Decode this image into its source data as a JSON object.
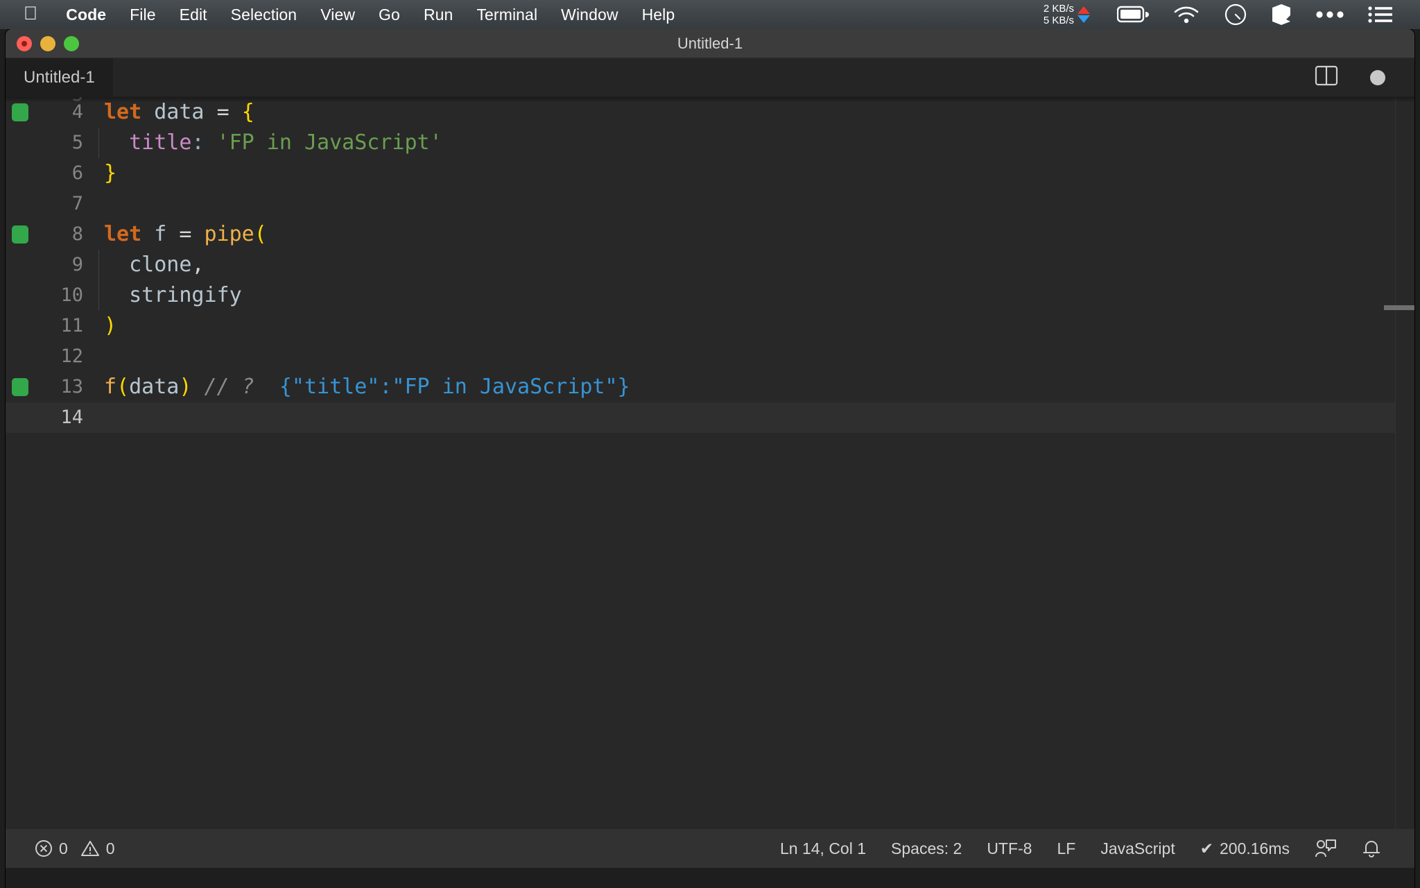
{
  "menubar": {
    "apple_glyph": "",
    "items": [
      {
        "label": "Code",
        "bold": true
      },
      {
        "label": "File",
        "bold": false
      },
      {
        "label": "Edit",
        "bold": false
      },
      {
        "label": "Selection",
        "bold": false
      },
      {
        "label": "View",
        "bold": false
      },
      {
        "label": "Go",
        "bold": false
      },
      {
        "label": "Run",
        "bold": false
      },
      {
        "label": "Terminal",
        "bold": false
      },
      {
        "label": "Window",
        "bold": false
      },
      {
        "label": "Help",
        "bold": false
      }
    ],
    "network": {
      "up": "2 KB/s",
      "down": "5 KB/s"
    },
    "icons": [
      "battery-icon",
      "wifi-icon",
      "control-center-icon",
      "app-icon",
      "more-icon",
      "list-icon"
    ]
  },
  "window": {
    "title": "Untitled-1",
    "traffic_lights": [
      "close-button",
      "minimize-button",
      "maximize-button"
    ]
  },
  "tabbar": {
    "tab_label": "Untitled-1",
    "split_editor_icon": "split-editor-icon",
    "unsaved_indicator": "unsaved-dot-icon"
  },
  "editor": {
    "lines": [
      {
        "number": "4",
        "gutter": true,
        "indent": false,
        "active": false,
        "tokens": [
          {
            "t": "let",
            "c": "kw"
          },
          {
            "t": " ",
            "c": "op"
          },
          {
            "t": "data",
            "c": "var"
          },
          {
            "t": " ",
            "c": "op"
          },
          {
            "t": "=",
            "c": "op"
          },
          {
            "t": " ",
            "c": "op"
          },
          {
            "t": "{",
            "c": "brc"
          }
        ]
      },
      {
        "number": "5",
        "gutter": false,
        "indent": true,
        "active": false,
        "tokens": [
          {
            "t": "  ",
            "c": "op"
          },
          {
            "t": "title",
            "c": "prop"
          },
          {
            "t": ":",
            "c": "colon"
          },
          {
            "t": " ",
            "c": "op"
          },
          {
            "t": "'FP in JavaScript'",
            "c": "str"
          }
        ]
      },
      {
        "number": "6",
        "gutter": false,
        "indent": false,
        "active": false,
        "tokens": [
          {
            "t": "}",
            "c": "brc"
          }
        ]
      },
      {
        "number": "7",
        "gutter": false,
        "indent": false,
        "active": false,
        "tokens": []
      },
      {
        "number": "8",
        "gutter": true,
        "indent": false,
        "active": false,
        "tokens": [
          {
            "t": "let",
            "c": "kw"
          },
          {
            "t": " ",
            "c": "op"
          },
          {
            "t": "f",
            "c": "var"
          },
          {
            "t": " ",
            "c": "op"
          },
          {
            "t": "=",
            "c": "op"
          },
          {
            "t": " ",
            "c": "op"
          },
          {
            "t": "pipe",
            "c": "fn"
          },
          {
            "t": "(",
            "c": "brc"
          }
        ]
      },
      {
        "number": "9",
        "gutter": false,
        "indent": true,
        "active": false,
        "tokens": [
          {
            "t": "  ",
            "c": "op"
          },
          {
            "t": "clone",
            "c": "var"
          },
          {
            "t": ",",
            "c": "op"
          }
        ]
      },
      {
        "number": "10",
        "gutter": false,
        "indent": true,
        "active": false,
        "tokens": [
          {
            "t": "  ",
            "c": "op"
          },
          {
            "t": "stringify",
            "c": "var"
          }
        ]
      },
      {
        "number": "11",
        "gutter": false,
        "indent": false,
        "active": false,
        "tokens": [
          {
            "t": ")",
            "c": "brc"
          }
        ]
      },
      {
        "number": "12",
        "gutter": false,
        "indent": false,
        "active": false,
        "tokens": []
      },
      {
        "number": "13",
        "gutter": true,
        "indent": false,
        "active": false,
        "tokens": [
          {
            "t": "f",
            "c": "fn"
          },
          {
            "t": "(",
            "c": "brc"
          },
          {
            "t": "data",
            "c": "var"
          },
          {
            "t": ")",
            "c": "brc"
          },
          {
            "t": " ",
            "c": "op"
          },
          {
            "t": "// ?",
            "c": "cmt"
          },
          {
            "t": "  ",
            "c": "op"
          },
          {
            "t": "{\"title\":\"FP in JavaScript\"}",
            "c": "res"
          }
        ]
      },
      {
        "number": "14",
        "gutter": false,
        "indent": false,
        "active": true,
        "tokens": []
      }
    ],
    "overview_marker": "overview-ruler-marker"
  },
  "statusbar": {
    "errors": "0",
    "warnings": "0",
    "cursor": "Ln 14, Col 1",
    "indentation": "Spaces: 2",
    "encoding": "UTF-8",
    "eol": "LF",
    "language": "JavaScript",
    "runtime": "200.16ms",
    "runtime_check": "✔",
    "feedback_icon": "feedback-icon",
    "bell_icon": "bell-icon"
  },
  "colors": {
    "editor_bg": "#282828",
    "gutter_marker_green": "#32a84a",
    "keyword_orange": "#d2691e",
    "brace_yellow": "#ffd700",
    "string_green": "#6a9e52",
    "property_purple": "#c98bc9",
    "result_blue": "#3794d4",
    "statusbar_bg": "#323233"
  }
}
